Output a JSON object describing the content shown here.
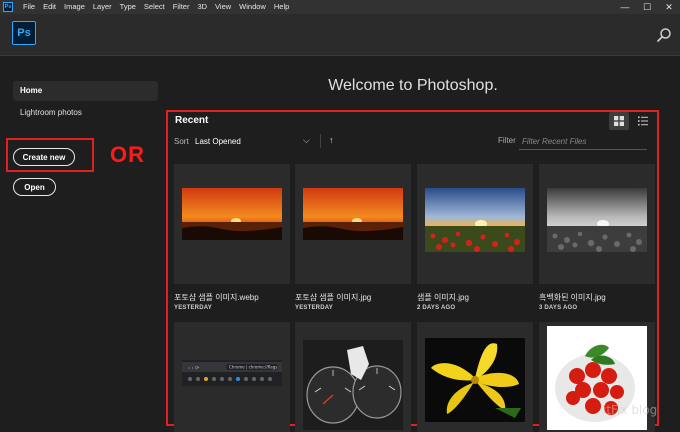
{
  "menubar": {
    "app_icon": "Ps",
    "items": [
      "File",
      "Edit",
      "Image",
      "Layer",
      "Type",
      "Select",
      "Filter",
      "3D",
      "View",
      "Window",
      "Help"
    ],
    "controls": [
      "—",
      "☐",
      "✕"
    ]
  },
  "header": {
    "logo": "Ps",
    "search_icon": "search-icon"
  },
  "sidebar": {
    "home": "Home",
    "lightroom": "Lightroom photos",
    "create_new": "Create new",
    "open": "Open"
  },
  "annotation": {
    "or": "OR",
    "highlight_color": "#e12020"
  },
  "welcome": "Welcome to Photoshop.",
  "recent": {
    "title": "Recent",
    "sort_label": "Sort",
    "sort_value": "Last Opened",
    "sort_arrow": "↑",
    "filter_label": "Filter",
    "filter_placeholder": "Filter Recent Files",
    "files": [
      {
        "name": "포토샵 샘플 이미지.webp",
        "date": "YESTERDAY",
        "thumb": "sunset-color"
      },
      {
        "name": "포토샵 샘플 이미지.jpg",
        "date": "YESTERDAY",
        "thumb": "sunset-color"
      },
      {
        "name": "샘플 이미지.jpg",
        "date": "2 DAYS AGO",
        "thumb": "poppy-field"
      },
      {
        "name": "흑백화된 이미지.jpg",
        "date": "3 DAYS AGO",
        "thumb": "poppy-field-bw"
      },
      {
        "name": "",
        "date": "",
        "thumb": "chrome-toolbar"
      },
      {
        "name": "",
        "date": "",
        "thumb": "car-gauge"
      },
      {
        "name": "",
        "date": "",
        "thumb": "yellow-lily"
      },
      {
        "name": "",
        "date": "",
        "thumb": "tomatoes"
      }
    ],
    "chrome_text": "Chrome | chrome://flags"
  },
  "watermark": "itFix blog",
  "colors": {
    "accent": "#31a8ff",
    "background": "#1e1e1e",
    "panel": "#2b2b2b",
    "annotation_red": "#ff1a1a"
  }
}
